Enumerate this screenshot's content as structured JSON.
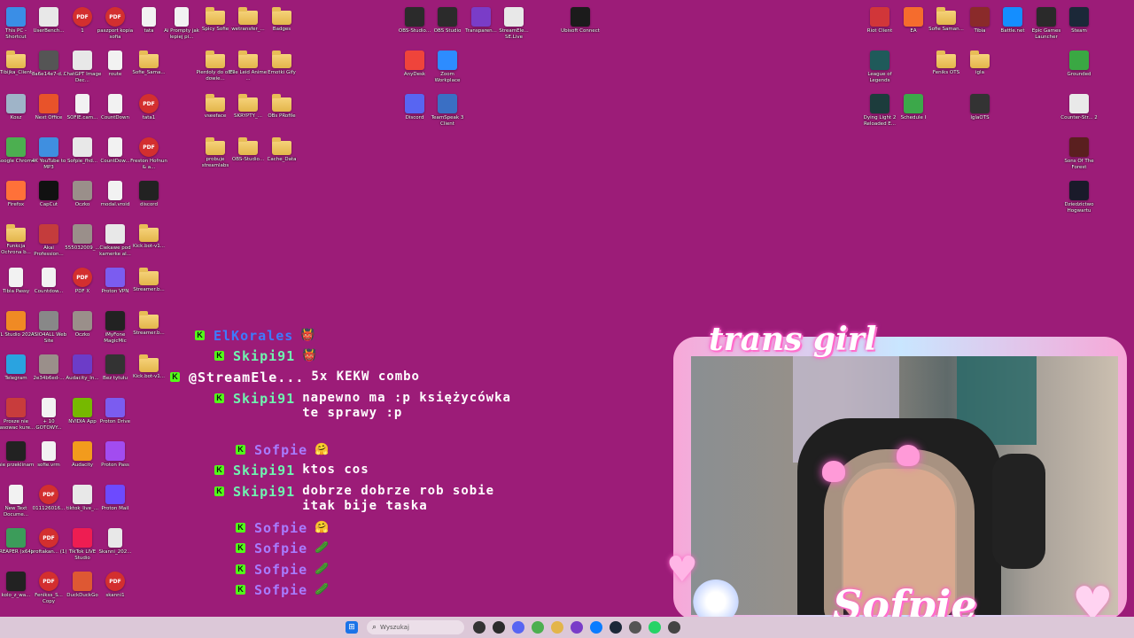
{
  "desktop_icons": [
    {
      "label": "This PC - Shortcut",
      "icon": "monitor-icon",
      "color": "#3a8ee6",
      "kind": "app"
    },
    {
      "label": "UserBench...",
      "icon": "gauge-icon",
      "color": "#e8e8e8",
      "kind": "app"
    },
    {
      "label": "1",
      "icon": "pdf-icon",
      "color": "#d32f2f",
      "kind": "app"
    },
    {
      "label": "paszport kopia sofia",
      "icon": "pdf-icon",
      "color": "#d32f2f",
      "kind": "app"
    },
    {
      "label": "tata",
      "icon": "file-icon",
      "color": "#f2f2f2",
      "kind": "file"
    },
    {
      "label": "Ai Prompty jak lepiej pi...",
      "icon": "file-icon",
      "color": "#f2f2f2",
      "kind": "file"
    },
    {
      "label": "Spicy Sofie",
      "icon": "folder-icon",
      "color": "#e3b54a",
      "kind": "folder"
    },
    {
      "label": "wetransfer_...",
      "icon": "folder-icon",
      "color": "#e3b54a",
      "kind": "folder"
    },
    {
      "label": "Badges",
      "icon": "folder-icon",
      "color": "#e3b54a",
      "kind": "folder"
    },
    {
      "label": "Tibijka_Client",
      "icon": "folder-icon",
      "color": "#e3b54a",
      "kind": "folder"
    },
    {
      "label": "8a6e14e7-d...",
      "icon": "image-icon",
      "color": "#555555",
      "kind": "app"
    },
    {
      "label": "ChatGPT Image Dec...",
      "icon": "image-icon",
      "color": "#e8e8e8",
      "kind": "app"
    },
    {
      "label": "route",
      "icon": "file-icon",
      "color": "#f2f2f2",
      "kind": "file"
    },
    {
      "label": "Sofie_Sama...",
      "icon": "folder-icon",
      "color": "#e3b54a",
      "kind": "folder"
    },
    {
      "label": "Pierdoly do oBS dowie...",
      "icon": "folder-icon",
      "color": "#e3b54a",
      "kind": "folder"
    },
    {
      "label": "Elle Leid Anime ...",
      "icon": "folder-icon",
      "color": "#e3b54a",
      "kind": "folder"
    },
    {
      "label": "Emotki Gify",
      "icon": "folder-icon",
      "color": "#e3b54a",
      "kind": "folder"
    },
    {
      "label": "Kosz",
      "icon": "trash-icon",
      "color": "#9fb4c8",
      "kind": "app"
    },
    {
      "label": "Next Office",
      "icon": "office-icon",
      "color": "#e8532a",
      "kind": "app"
    },
    {
      "label": "SOFIE.cam...",
      "icon": "file-icon",
      "color": "#f2f2f2",
      "kind": "file"
    },
    {
      "label": "CountDown",
      "icon": "file-icon",
      "color": "#f2f2f2",
      "kind": "file"
    },
    {
      "label": "tata1",
      "icon": "pdf-icon",
      "color": "#d32f2f",
      "kind": "app"
    },
    {
      "label": "vseeface",
      "icon": "folder-icon",
      "color": "#e3b54a",
      "kind": "folder"
    },
    {
      "label": "SKRYPTY_...",
      "icon": "folder-icon",
      "color": "#e3b54a",
      "kind": "folder"
    },
    {
      "label": "OBs PRofile",
      "icon": "folder-icon",
      "color": "#e3b54a",
      "kind": "folder"
    },
    {
      "label": "Google Chrome",
      "icon": "chrome-icon",
      "color": "#4caf50",
      "kind": "app"
    },
    {
      "label": "4K YouTube to MP3",
      "icon": "cloud-icon",
      "color": "#3f8fe0",
      "kind": "app"
    },
    {
      "label": "Sofpie_fhd...",
      "icon": "image-icon",
      "color": "#e8e8e8",
      "kind": "app"
    },
    {
      "label": "CountDow...",
      "icon": "file-icon",
      "color": "#f2f2f2",
      "kind": "file"
    },
    {
      "label": "Freston Hofnun & a...",
      "icon": "pdf-icon",
      "color": "#d32f2f",
      "kind": "app"
    },
    {
      "label": "probuje streamlabs",
      "icon": "folder-icon",
      "color": "#e3b54a",
      "kind": "folder"
    },
    {
      "label": "OBS-Studio...",
      "icon": "folder-icon",
      "color": "#e3b54a",
      "kind": "folder"
    },
    {
      "label": "Cache_Data",
      "icon": "folder-icon",
      "color": "#e3b54a",
      "kind": "folder"
    },
    {
      "label": "Firefox",
      "icon": "firefox-icon",
      "color": "#ff7139",
      "kind": "app"
    },
    {
      "label": "CapCut",
      "icon": "capcut-icon",
      "color": "#111111",
      "kind": "app"
    },
    {
      "label": "Oczko",
      "icon": "image-icon",
      "color": "#9a8f8a",
      "kind": "app"
    },
    {
      "label": "modal.vroid",
      "icon": "file-icon",
      "color": "#f2f2f2",
      "kind": "file"
    },
    {
      "label": "discord",
      "icon": "image-icon",
      "color": "#222222",
      "kind": "app"
    },
    {
      "label": "Funkcja Ochrona b...",
      "icon": "folder-icon",
      "color": "#e3b54a",
      "kind": "folder"
    },
    {
      "label": "Akai Profession...",
      "icon": "mpk-icon",
      "color": "#c43c3c",
      "kind": "app"
    },
    {
      "label": "555032009_...",
      "icon": "image-icon",
      "color": "#9a8f8a",
      "kind": "app"
    },
    {
      "label": "Ciekawe pod kamerke al...",
      "icon": "image-icon",
      "color": "#e8e8e8",
      "kind": "app"
    },
    {
      "label": "Kick.bot-v1...",
      "icon": "folder-icon",
      "color": "#e3b54a",
      "kind": "folder"
    },
    {
      "label": "Tibia Passy",
      "icon": "file-icon",
      "color": "#f2f2f2",
      "kind": "file"
    },
    {
      "label": "Countdow...",
      "icon": "file-icon",
      "color": "#f2f2f2",
      "kind": "file"
    },
    {
      "label": "PDF X",
      "icon": "pdf-icon",
      "color": "#d32f2f",
      "kind": "app"
    },
    {
      "label": "Proton VPN",
      "icon": "proton-vpn-icon",
      "color": "#7b5cf0",
      "kind": "app"
    },
    {
      "label": "Streamer.b...",
      "icon": "folder-icon",
      "color": "#e3b54a",
      "kind": "folder"
    },
    {
      "label": "FL Studio 2024",
      "icon": "fl-studio-icon",
      "color": "#f08a24",
      "kind": "app"
    },
    {
      "label": "ASIO4ALL Web Site",
      "icon": "asio-icon",
      "color": "#888888",
      "kind": "app"
    },
    {
      "label": "Oczko",
      "icon": "image-icon",
      "color": "#9a8f8a",
      "kind": "app"
    },
    {
      "label": "iMyFone MagicMic",
      "icon": "magicmic-icon",
      "color": "#222222",
      "kind": "app"
    },
    {
      "label": "Streamer.b...",
      "icon": "folder-icon",
      "color": "#e3b54a",
      "kind": "folder"
    },
    {
      "label": "Telegram",
      "icon": "telegram-icon",
      "color": "#2aa3e0",
      "kind": "app"
    },
    {
      "label": "2e34b6ed-...",
      "icon": "image-icon",
      "color": "#9a8f8a",
      "kind": "app"
    },
    {
      "label": "Audacity_In...",
      "icon": "audacity-icon",
      "color": "#6c3cc8",
      "kind": "app"
    },
    {
      "label": "Bez tytułu",
      "icon": "image-icon",
      "color": "#333333",
      "kind": "app"
    },
    {
      "label": "Kick.bot-v1...",
      "icon": "folder-icon",
      "color": "#e3b54a",
      "kind": "folder"
    },
    {
      "label": "Prosze nie kasowac kure...",
      "icon": "image-icon",
      "color": "#c83c3c",
      "kind": "app"
    },
    {
      "label": "+ 10 GOTOWY...",
      "icon": "file-icon",
      "color": "#f2f2f2",
      "kind": "file"
    },
    {
      "label": "NVIDIA App",
      "icon": "nvidia-icon",
      "color": "#76b900",
      "kind": "app"
    },
    {
      "label": "Proton Drive",
      "icon": "proton-drive-icon",
      "color": "#7b5cf0",
      "kind": "app"
    },
    {
      "label": "nie przeklinam",
      "icon": "image-icon",
      "color": "#222222",
      "kind": "app"
    },
    {
      "label": "sofie.vrm",
      "icon": "file-icon",
      "color": "#f2f2f2",
      "kind": "file"
    },
    {
      "label": "Audacity",
      "icon": "audacity-icon",
      "color": "#f29b1d",
      "kind": "app"
    },
    {
      "label": "Proton Pass",
      "icon": "proton-pass-icon",
      "color": "#a24cf0",
      "kind": "app"
    },
    {
      "label": "New Text Docume...",
      "icon": "file-icon",
      "color": "#f2f2f2",
      "kind": "file"
    },
    {
      "label": "011126016...",
      "icon": "pdf-icon",
      "color": "#d32f2f",
      "kind": "app"
    },
    {
      "label": "tiktok_live_...",
      "icon": "tiktok-icon",
      "color": "#e8e8e8",
      "kind": "app"
    },
    {
      "label": "Proton Mail",
      "icon": "proton-mail-icon",
      "color": "#6d4aff",
      "kind": "app"
    },
    {
      "label": "REAPER (x64)",
      "icon": "reaper-icon",
      "color": "#3c9c5a",
      "kind": "app"
    },
    {
      "label": "proftakan... (1)",
      "icon": "pdf-icon",
      "color": "#d32f2f",
      "kind": "app"
    },
    {
      "label": "TikTok LIVE Studio",
      "icon": "tiktok-icon",
      "color": "#ee1d52",
      "kind": "app"
    },
    {
      "label": "Skanni_202...",
      "icon": "file-icon",
      "color": "#e8e8e8",
      "kind": "file"
    },
    {
      "label": "kolo_z_wa...",
      "icon": "image-icon",
      "color": "#222222",
      "kind": "app"
    },
    {
      "label": "Fenikss_S... Copy",
      "icon": "pdf-icon",
      "color": "#d32f2f",
      "kind": "app"
    },
    {
      "label": "DuckDuckGo",
      "icon": "duckduckgo-icon",
      "color": "#de5833",
      "kind": "app"
    },
    {
      "label": "skanni1",
      "icon": "pdf-icon",
      "color": "#d32f2f",
      "kind": "app"
    },
    {
      "label": "OBS-Studio...",
      "icon": "obs-icon",
      "color": "#2b2b2b",
      "kind": "app"
    },
    {
      "label": "OBS Studio",
      "icon": "obs-icon",
      "color": "#2b2b2b",
      "kind": "app"
    },
    {
      "label": "Transparen...",
      "icon": "transparent-icon",
      "color": "#7a3cc8",
      "kind": "app"
    },
    {
      "label": "StreamEle... SE.Live",
      "icon": "streamelements-icon",
      "color": "#e8e8e8",
      "kind": "app"
    },
    {
      "label": "Ubisoft Connect",
      "icon": "ubisoft-icon",
      "color": "#1b1b1b",
      "kind": "app"
    },
    {
      "label": "AnyDesk",
      "icon": "anydesk-icon",
      "color": "#ef443b",
      "kind": "app"
    },
    {
      "label": "Zoom Workplace",
      "icon": "zoom-icon",
      "color": "#2d8cff",
      "kind": "app"
    },
    {
      "label": "Discord",
      "icon": "discord-icon",
      "color": "#5865f2",
      "kind": "app"
    },
    {
      "label": "TeamSpeak 3 Client",
      "icon": "teamspeak-icon",
      "color": "#3a6fc4",
      "kind": "app"
    },
    {
      "label": "Riot Client",
      "icon": "riot-icon",
      "color": "#d13639",
      "kind": "app"
    },
    {
      "label": "EA",
      "icon": "ea-icon",
      "color": "#f56c2d",
      "kind": "app"
    },
    {
      "label": "Sofie Saman...",
      "icon": "folder-icon",
      "color": "#e3b54a",
      "kind": "folder"
    },
    {
      "label": "Tibia",
      "icon": "tibia-icon",
      "color": "#8a2a2a",
      "kind": "app"
    },
    {
      "label": "Battle.net",
      "icon": "battlenet-icon",
      "color": "#148eff",
      "kind": "app"
    },
    {
      "label": "Epic Games Launcher",
      "icon": "epic-icon",
      "color": "#2a2a2a",
      "kind": "app"
    },
    {
      "label": "Steam",
      "icon": "steam-icon",
      "color": "#1b2838",
      "kind": "app"
    },
    {
      "label": "League of Legends",
      "icon": "lol-icon",
      "color": "#1f5a5a",
      "kind": "app"
    },
    {
      "label": "Feniks OTS",
      "icon": "folder-icon",
      "color": "#e3b54a",
      "kind": "folder"
    },
    {
      "label": "igla",
      "icon": "folder-icon",
      "color": "#e3b54a",
      "kind": "folder"
    },
    {
      "label": "Grounded",
      "icon": "grounded-icon",
      "color": "#3aa843",
      "kind": "app"
    },
    {
      "label": "Dying Light 2 Reloaded E...",
      "icon": "dyinglight-icon",
      "color": "#1c3c3c",
      "kind": "app"
    },
    {
      "label": "Schedule I",
      "icon": "schedule-icon",
      "color": "#3ca84a",
      "kind": "app"
    },
    {
      "label": "IglaOTS",
      "icon": "iglaots-icon",
      "color": "#333333",
      "kind": "app"
    },
    {
      "label": "Counter-Str... 2",
      "icon": "cs2-icon",
      "color": "#e9e9e9",
      "kind": "app"
    },
    {
      "label": "Sons Of The Forest",
      "icon": "sotf-icon",
      "color": "#5a1f1f",
      "kind": "app"
    },
    {
      "label": "Dziedzictwo Hogwartu",
      "icon": "hogwarts-icon",
      "color": "#1a1a2a",
      "kind": "app"
    }
  ],
  "chat": [
    {
      "user": "ElKorales",
      "user_color": "#3d7bff",
      "text": "",
      "emote": "👹"
    },
    {
      "user": "Skipi91",
      "user_color": "#6ff5b0",
      "text": "",
      "emote": "👹"
    },
    {
      "user": "@StreamEle...",
      "user_color": "#ffffff",
      "text": "5x KEKW combo",
      "emote": ""
    },
    {
      "user": "Skipi91",
      "user_color": "#6ff5b0",
      "text": "napewno ma :p księżycówka te sprawy :p",
      "emote": ""
    },
    {
      "user": "Sofpie",
      "user_color": "#a77cff",
      "text": "",
      "emote": "🤗"
    },
    {
      "user": "Skipi91",
      "user_color": "#6ff5b0",
      "text": "ktos cos",
      "emote": ""
    },
    {
      "user": "Skipi91",
      "user_color": "#6ff5b0",
      "text": "dobrze dobrze rob sobie itak bije taska",
      "emote": ""
    },
    {
      "user": "Sofpie",
      "user_color": "#a77cff",
      "text": "",
      "emote": "🤗"
    },
    {
      "user": "Sofpie",
      "user_color": "#a77cff",
      "text": "",
      "emote": "🥒"
    },
    {
      "user": "Sofpie",
      "user_color": "#a77cff",
      "text": "",
      "emote": "🥒"
    },
    {
      "user": "Sofpie",
      "user_color": "#a77cff",
      "text": "",
      "emote": "🥒"
    }
  ],
  "chat_badge": "K",
  "webcam": {
    "title": "trans girl",
    "name": "Sofpie"
  },
  "taskbar": {
    "search_placeholder": "Wyszukaj",
    "apps": [
      {
        "icon": "windows-start-icon",
        "color": "#1a73e8"
      },
      {
        "icon": "task-view-icon",
        "color": "#333333"
      },
      {
        "icon": "obs-icon",
        "color": "#2b2b2b"
      },
      {
        "icon": "discord-icon",
        "color": "#5865f2"
      },
      {
        "icon": "chrome-icon",
        "color": "#4caf50"
      },
      {
        "icon": "file-explorer-icon",
        "color": "#e3b54a"
      },
      {
        "icon": "streamelements-icon",
        "color": "#7a3cc8"
      },
      {
        "icon": "messenger-icon",
        "color": "#0a7cff"
      },
      {
        "icon": "steam-icon",
        "color": "#1b2838"
      },
      {
        "icon": "settings-icon",
        "color": "#555555"
      },
      {
        "icon": "whatsapp-icon",
        "color": "#25d366"
      },
      {
        "icon": "app-icon",
        "color": "#444444"
      }
    ]
  }
}
